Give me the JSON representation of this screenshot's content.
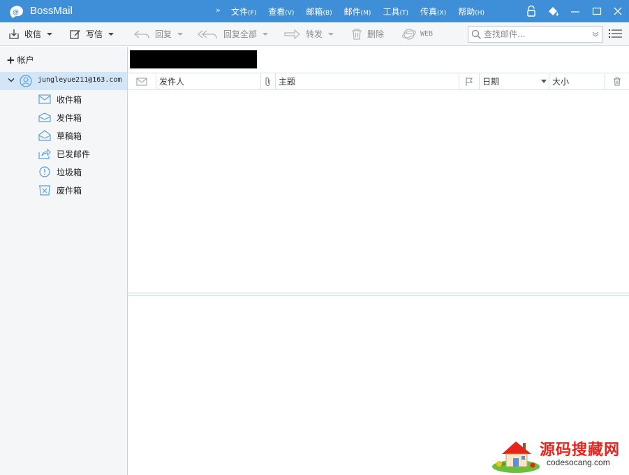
{
  "app": {
    "title": "BossMail"
  },
  "menu": [
    {
      "label": "文件",
      "accel": "(F)"
    },
    {
      "label": "查看",
      "accel": "(V)"
    },
    {
      "label": "邮箱",
      "accel": "(B)"
    },
    {
      "label": "邮件",
      "accel": "(M)"
    },
    {
      "label": "工具",
      "accel": "(T)"
    },
    {
      "label": "传真",
      "accel": "(X)"
    },
    {
      "label": "帮助",
      "accel": "(H)"
    }
  ],
  "toolbar": {
    "receive": "收信",
    "compose": "写信",
    "reply": "回复",
    "reply_all": "回复全部",
    "forward": "转发",
    "delete": "删除",
    "web": "WEB",
    "search_placeholder": "查找邮件..."
  },
  "sidebar": {
    "add_account": "帐户",
    "account": "jungleyue211@163.com",
    "folders": [
      {
        "label": "收件箱",
        "icon": "inbox-icon"
      },
      {
        "label": "发件箱",
        "icon": "outbox-icon"
      },
      {
        "label": "草稿箱",
        "icon": "drafts-icon"
      },
      {
        "label": "已发邮件",
        "icon": "sent-icon"
      },
      {
        "label": "垃圾箱",
        "icon": "spam-icon"
      },
      {
        "label": "废件箱",
        "icon": "trash-icon"
      }
    ]
  },
  "columns": {
    "sender": "发件人",
    "subject": "主题",
    "date": "日期",
    "size": "大小"
  },
  "watermark": {
    "title": "源码搜藏网",
    "url": "codesocang.com"
  },
  "colors": {
    "titlebar": "#3f8fd8",
    "selected_row": "#d3e6f7",
    "watermark_red": "#e7241c"
  }
}
